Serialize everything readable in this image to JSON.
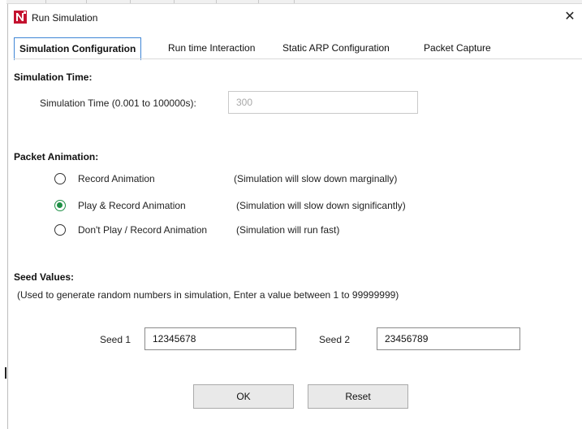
{
  "window": {
    "title": "Run Simulation"
  },
  "tabs": [
    {
      "label": "Simulation Configuration",
      "active": true
    },
    {
      "label": "Run time Interaction",
      "active": false
    },
    {
      "label": "Static ARP Configuration",
      "active": false
    },
    {
      "label": "Packet Capture",
      "active": false
    }
  ],
  "simulation_time": {
    "heading": "Simulation Time:",
    "label": "Simulation Time (0.001 to 100000s):",
    "value": "300"
  },
  "packet_animation": {
    "heading": "Packet Animation:",
    "options": [
      {
        "label": "Record Animation",
        "note": "(Simulation will slow down marginally)",
        "selected": false
      },
      {
        "label": "Play & Record Animation",
        "note": "(Simulation will slow down significantly)",
        "selected": true
      },
      {
        "label": "Don't Play / Record Animation",
        "note": "(Simulation will run fast)",
        "selected": false
      }
    ]
  },
  "seed_values": {
    "heading": "Seed Values:",
    "hint": "(Used to generate random numbers in simulation, Enter a value between 1 to 99999999)",
    "seed1_label": "Seed 1",
    "seed1_value": "12345678",
    "seed2_label": "Seed 2",
    "seed2_value": "23456789"
  },
  "buttons": {
    "ok": "OK",
    "reset": "Reset"
  },
  "colors": {
    "tab_border": "#3f86d6",
    "radio_selected": "#1e8f45",
    "icon_red": "#c4122f"
  },
  "icons": {
    "app": "netsim-logo-icon",
    "close": "close-icon"
  }
}
